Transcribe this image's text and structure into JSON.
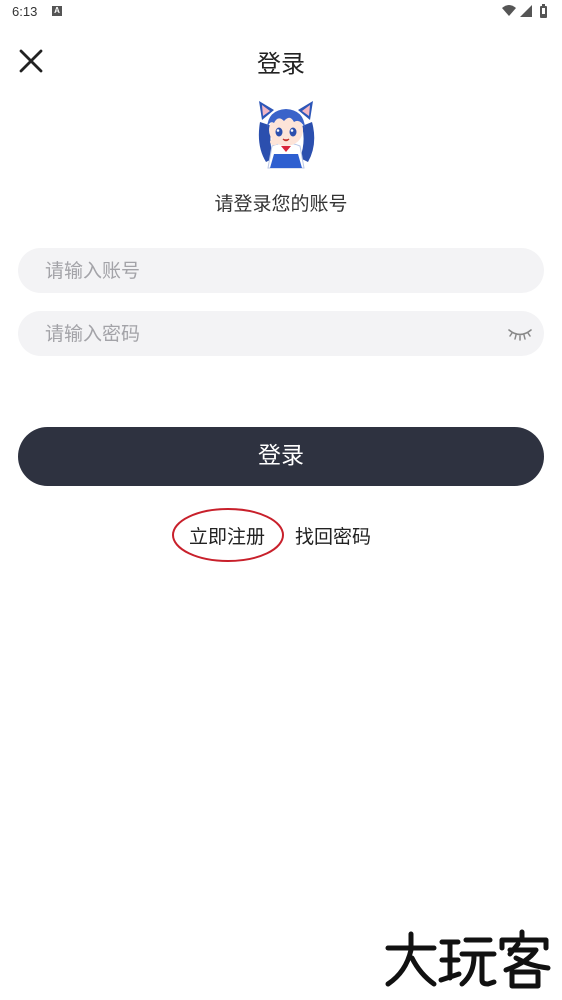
{
  "status_bar": {
    "time": "6:13",
    "notification_badge": "A",
    "icons": [
      "wifi-icon",
      "signal-icon",
      "battery-icon"
    ]
  },
  "header": {
    "title": "登录",
    "close_icon": "close-icon"
  },
  "avatar": {
    "icon": "anime-catgirl-avatar"
  },
  "subtitle": "请登录您的账号",
  "form": {
    "account_placeholder": "请输入账号",
    "account_value": "",
    "password_placeholder": "请输入密码",
    "password_value": "",
    "password_toggle_icon": "eye-closed-icon"
  },
  "login_button_label": "登录",
  "links": {
    "register": "立即注册",
    "recover_password": "找回密码"
  },
  "watermark": "大玩客",
  "colors": {
    "button_bg": "#2e3240",
    "input_bg": "#f3f3f5",
    "highlight_ring": "#c8202b"
  }
}
